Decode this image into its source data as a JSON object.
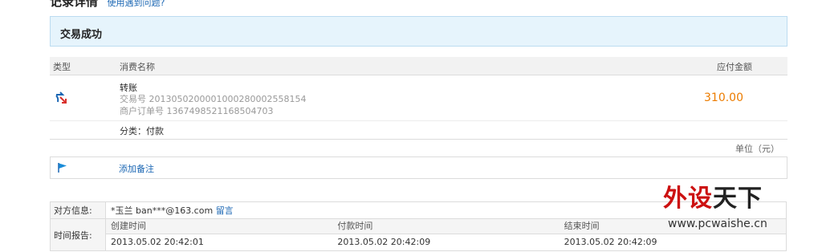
{
  "header": {
    "title": "记录详情",
    "help_link": "使用遇到问题?"
  },
  "status": {
    "text": "交易成功"
  },
  "table": {
    "headers": {
      "type": "类型",
      "name": "消费名称",
      "amount": "应付金额"
    },
    "row": {
      "icon": "transfer-icon",
      "name": "转账",
      "trade_no": "交易号 2013050200001000280002558154",
      "merchant_order": "商户订单号 1367498521168504703",
      "amount": "310.00",
      "category": "分类：付款"
    }
  },
  "unit": "单位（元）",
  "note": {
    "icon": "flag-icon",
    "link": "添加备注"
  },
  "counterparty": {
    "label": "对方信息:",
    "value": "*玉兰  ban***@163.com",
    "message_link": "留言"
  },
  "time_report": {
    "label": "时间报告:",
    "columns": [
      {
        "head": "创建时间",
        "value": "2013.05.02 20:42:01"
      },
      {
        "head": "付款时间",
        "value": "2013.05.02 20:42:09"
      },
      {
        "head": "结束时间",
        "value": "2013.05.02 20:42:09"
      }
    ]
  },
  "watermark": {
    "brand": "外设天下",
    "url": "www.pcwaishe.cn"
  },
  "colors": {
    "accent": "#1a66b3",
    "amount": "#ec7c00",
    "status_bg": "#e6f4fc",
    "watermark_red": "#cc1111"
  }
}
